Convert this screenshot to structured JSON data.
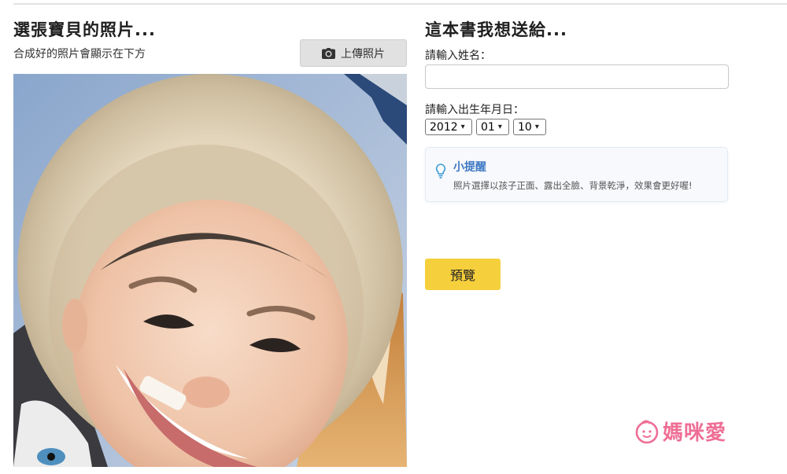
{
  "left": {
    "title": "選張寶貝的照片...",
    "subtitle": "合成好的照片會顯示在下方",
    "upload_button": {
      "label": "上傳照片",
      "icon": "camera-icon"
    },
    "photo": {
      "subject": "smiling-child-in-fur-hood"
    }
  },
  "right": {
    "title": "這本書我想送給...",
    "name_label": "請輸入姓名：",
    "name_value": "",
    "birthday_label": "請輸入出生年月日：",
    "birthday": {
      "year": "2012",
      "month": "01",
      "day": "10"
    },
    "tip": {
      "icon": "lightbulb-icon",
      "title": "小提醒",
      "text": "照片選擇以孩子正面、露出全臉、背景乾淨，效果會更好喔!"
    },
    "preview_button": "預覽"
  },
  "watermark": {
    "text": "媽咪愛",
    "icon": "baby-face-logo"
  },
  "colors": {
    "accent_yellow": "#f6cf3c",
    "tip_blue": "#3d78c4",
    "watermark_pink": "#ef6e96"
  }
}
